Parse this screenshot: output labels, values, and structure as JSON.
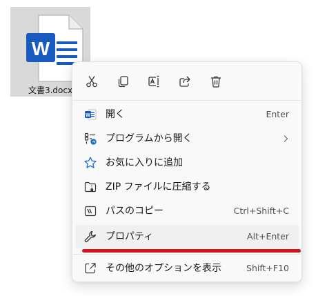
{
  "file": {
    "name": "文書3.docx",
    "icon": "word-document-icon",
    "tile_color": "#d9d9d9",
    "brand_color": "#185abd"
  },
  "quick_actions": [
    {
      "icon": "cut-icon"
    },
    {
      "icon": "copy-icon"
    },
    {
      "icon": "rename-icon"
    },
    {
      "icon": "share-icon"
    },
    {
      "icon": "delete-icon"
    }
  ],
  "menu": {
    "open": {
      "label": "開く",
      "shortcut": "Enter",
      "icon": "word-icon"
    },
    "open_with": {
      "label": "プログラムから開く",
      "icon": "open-with-icon",
      "submenu_icon": "chevron-right-icon"
    },
    "favorites": {
      "label": "お気に入りに追加",
      "icon": "star-icon"
    },
    "zip": {
      "label": "ZIP ファイルに圧縮する",
      "icon": "zip-folder-icon"
    },
    "copy_path": {
      "label": "パスのコピー",
      "shortcut": "Ctrl+Shift+C",
      "icon": "copy-path-icon"
    },
    "properties": {
      "label": "プロパティ",
      "shortcut": "Alt+Enter",
      "icon": "wrench-icon"
    },
    "more_options": {
      "label": "その他のオプションを表示",
      "shortcut": "Shift+F10",
      "icon": "more-options-icon"
    }
  },
  "annotation_color": "#d4141c"
}
